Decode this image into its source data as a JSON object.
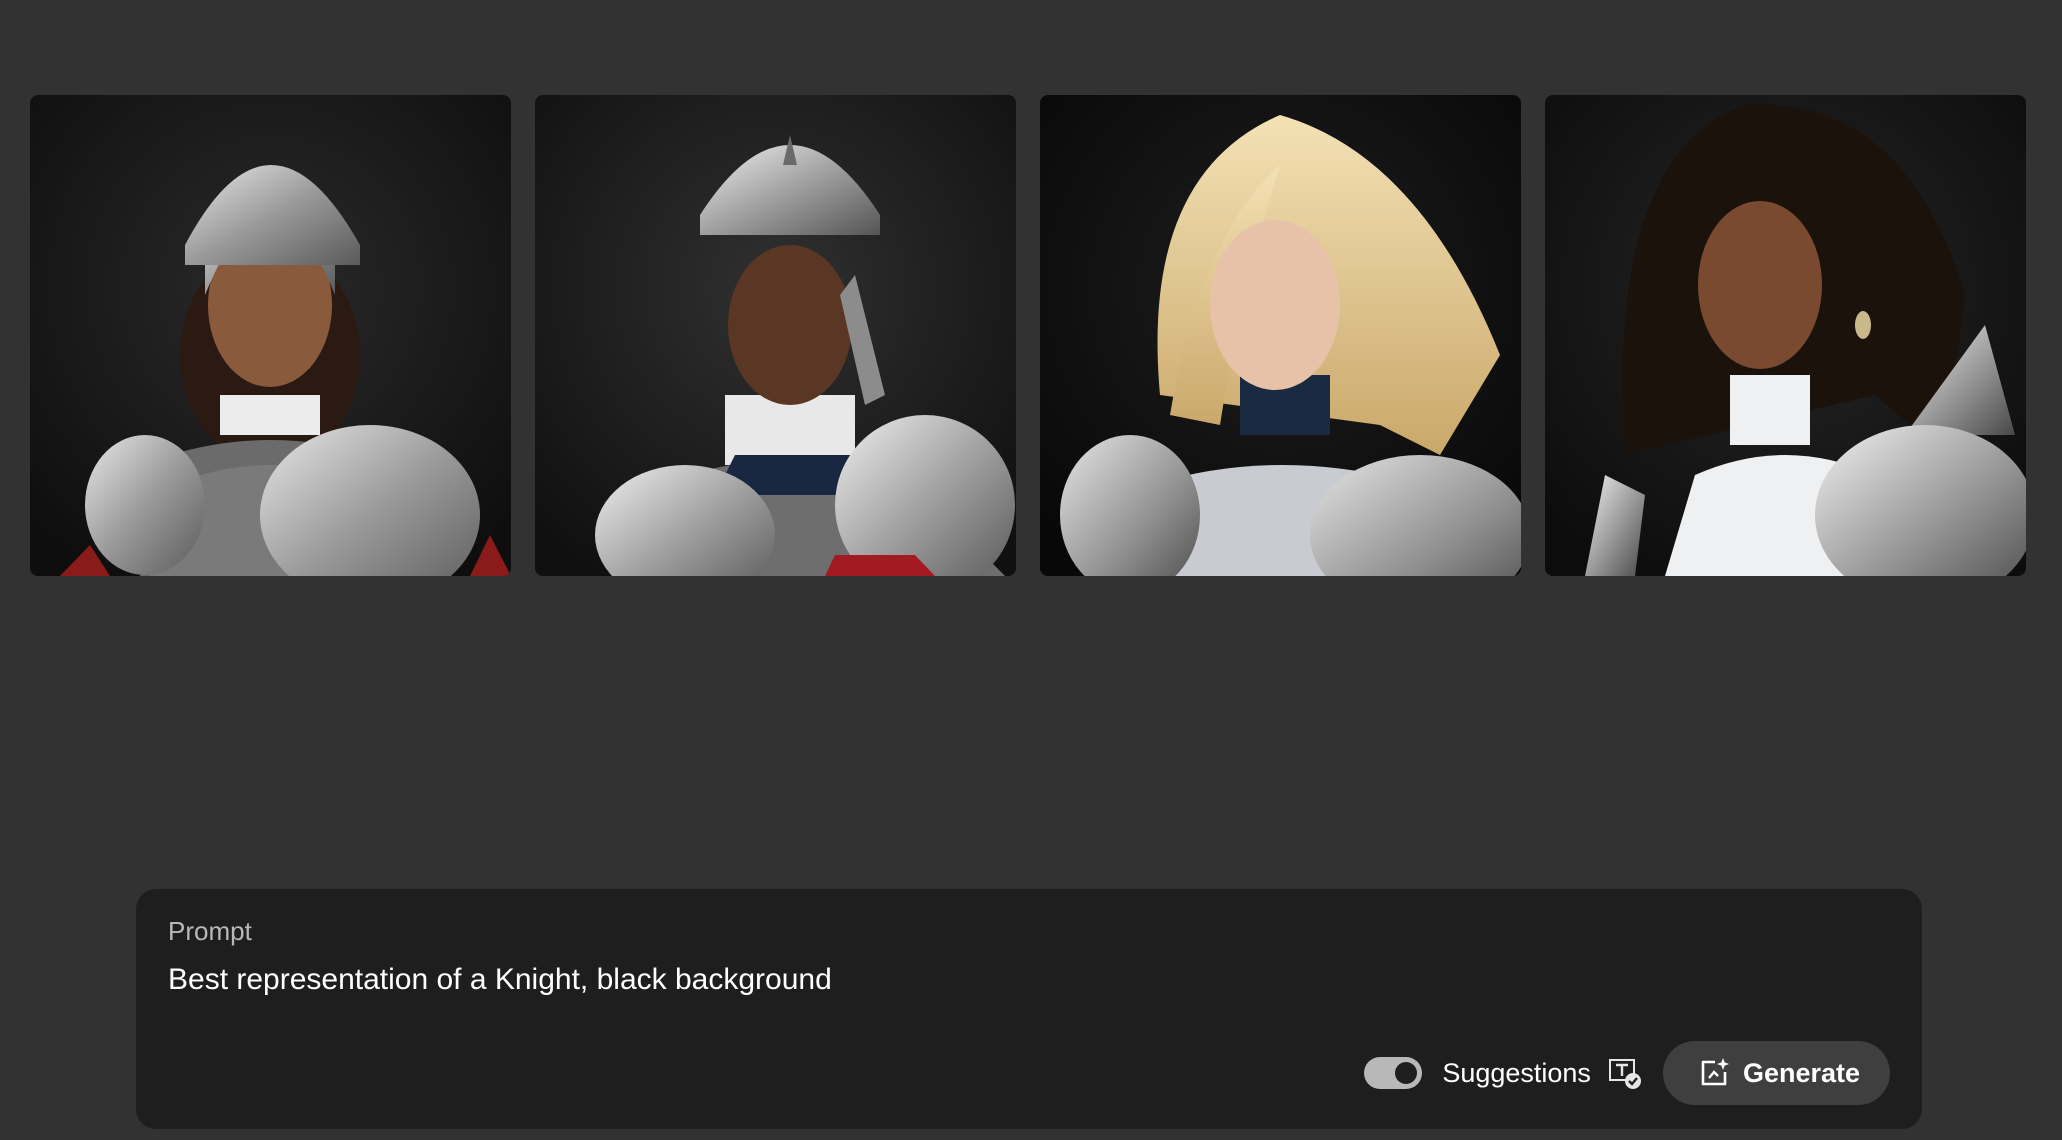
{
  "gallery": {
    "images": [
      {
        "name": "knight-1",
        "alt": "Knight with round helmet and chainmail"
      },
      {
        "name": "knight-2",
        "alt": "Knight with pointed helmet and chainmail"
      },
      {
        "name": "knight-3",
        "alt": "Blonde woman in silver armor"
      },
      {
        "name": "knight-4",
        "alt": "Woman with dark curly hair in spiked armor"
      }
    ]
  },
  "prompt": {
    "label": "Prompt",
    "value": "Best representation of a Knight, black background"
  },
  "controls": {
    "suggestions_label": "Suggestions",
    "suggestions_on": true,
    "generate_label": "Generate",
    "suggest_icon": "text-check-icon",
    "generate_icon": "generate-sparkle-icon"
  },
  "colors": {
    "background": "#323232",
    "panel": "#1e1e1e",
    "button": "#3f3f3f",
    "text": "#ffffff",
    "muted": "#b8b8b8"
  }
}
